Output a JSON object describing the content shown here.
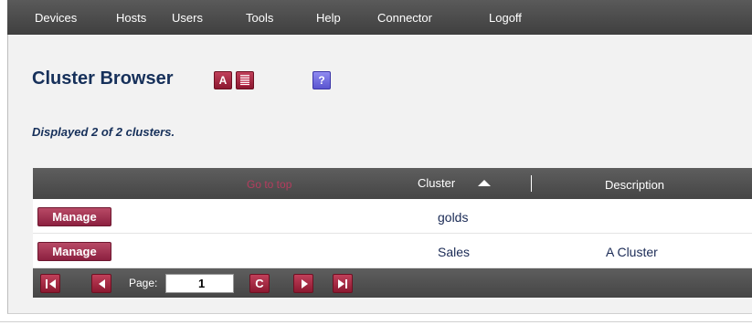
{
  "nav": {
    "items": [
      {
        "label": "Devices"
      },
      {
        "label": "Hosts"
      },
      {
        "label": "Users"
      },
      {
        "label": "Tools"
      },
      {
        "label": "Help"
      },
      {
        "label": "Connector"
      },
      {
        "label": "Logoff"
      }
    ]
  },
  "header": {
    "title": "Cluster Browser",
    "a_button_label": "A",
    "help_button_label": "?"
  },
  "status_text": "Displayed 2 of 2 clusters.",
  "table": {
    "go_to_top": "Go to top",
    "columns": {
      "cluster": "Cluster",
      "description": "Description"
    },
    "sort": {
      "column": "cluster",
      "direction": "ascending"
    },
    "rows": [
      {
        "action": "Manage",
        "cluster": "golds",
        "description": ""
      },
      {
        "action": "Manage",
        "cluster": "Sales",
        "description": "A Cluster"
      }
    ]
  },
  "pager": {
    "page_label": "Page:",
    "page_value": "1",
    "refresh_glyph": "C",
    "icons": [
      "first-page-icon",
      "previous-page-icon",
      "refresh-icon",
      "next-page-icon",
      "last-page-icon"
    ]
  },
  "colors": {
    "topbar": "#4a4a4a",
    "panel": "#f2f2f2",
    "title": "#16305a",
    "button_red": "#a02c48",
    "help_purple": "#6f69e0",
    "go_to_top": "#b53c5e"
  }
}
